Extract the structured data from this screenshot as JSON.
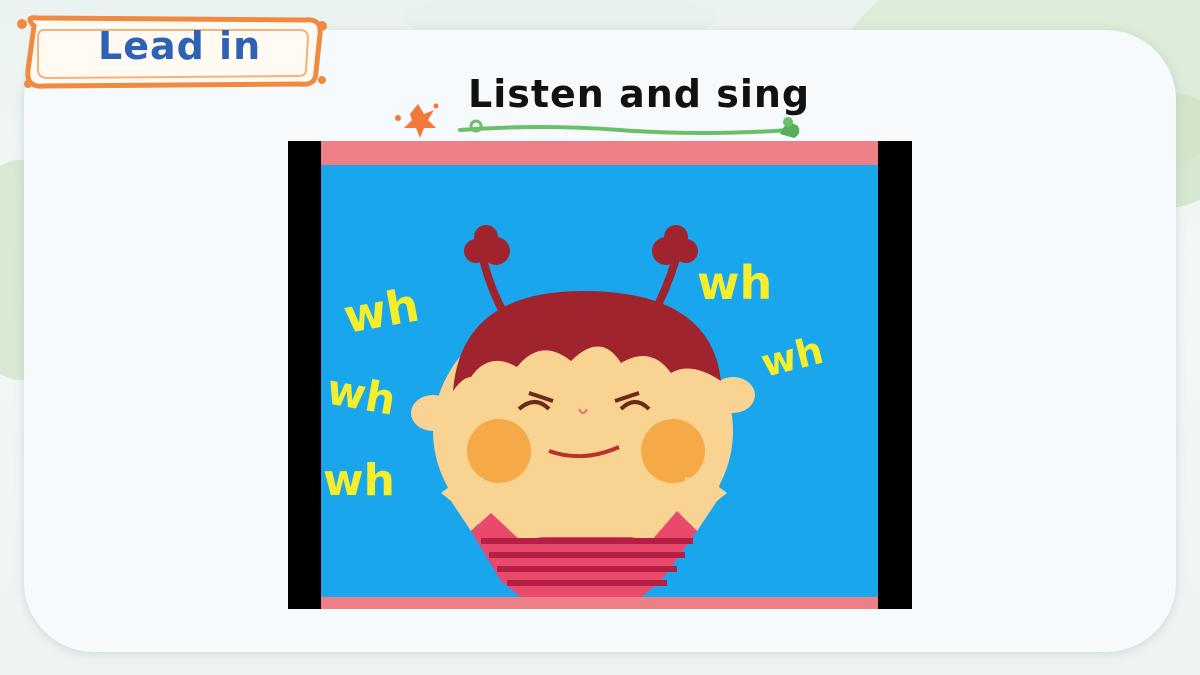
{
  "header": {
    "badge_label": "Lead in"
  },
  "slide": {
    "title": "Listen and sing"
  },
  "video": {
    "words": [
      "wh",
      "wh",
      "wh",
      "wh",
      "wh"
    ]
  },
  "colors": {
    "badge_text": "#2e63b4",
    "badge_border": "#f08a40",
    "video_bg": "#1aa6ec",
    "frame_band": "#ef7f86",
    "letters": "#f4ee2c"
  }
}
